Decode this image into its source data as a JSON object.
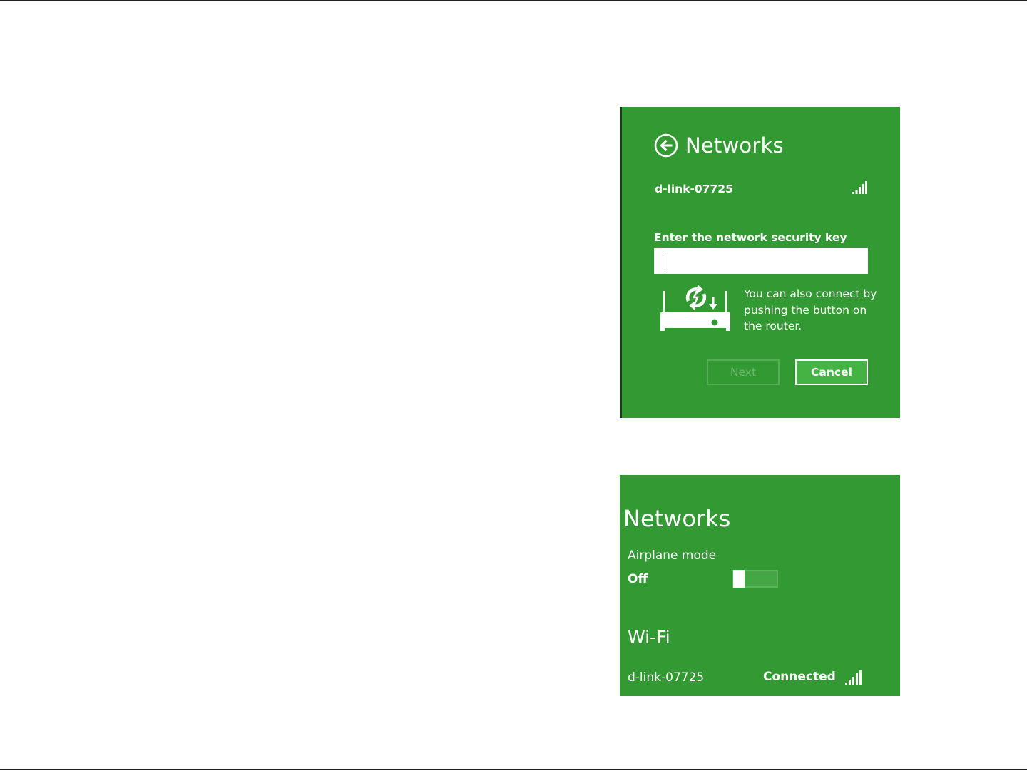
{
  "colors": {
    "panel_green": "#339933",
    "text": "#ffffff",
    "toggle_thumb": "#ffffff"
  },
  "security_key_panel": {
    "back_icon": "back-arrow-circle-icon",
    "title": "Networks",
    "network_name": "d-link-07725",
    "signal_icon": "signal-bars-icon",
    "security_key_label": "Enter the network security key",
    "security_key_value": "",
    "wps_icon": "router-wps-icon",
    "wps_text": "You can also connect by pushing the button on the router.",
    "next_label": "Next",
    "cancel_label": "Cancel"
  },
  "networks_panel": {
    "title": "Networks",
    "airplane_mode_label": "Airplane mode",
    "airplane_mode_state": "Off",
    "airplane_mode_on": false,
    "wifi_heading": "Wi-Fi",
    "network_name": "d-link-07725",
    "network_status": "Connected",
    "signal_icon": "signal-bars-icon"
  }
}
